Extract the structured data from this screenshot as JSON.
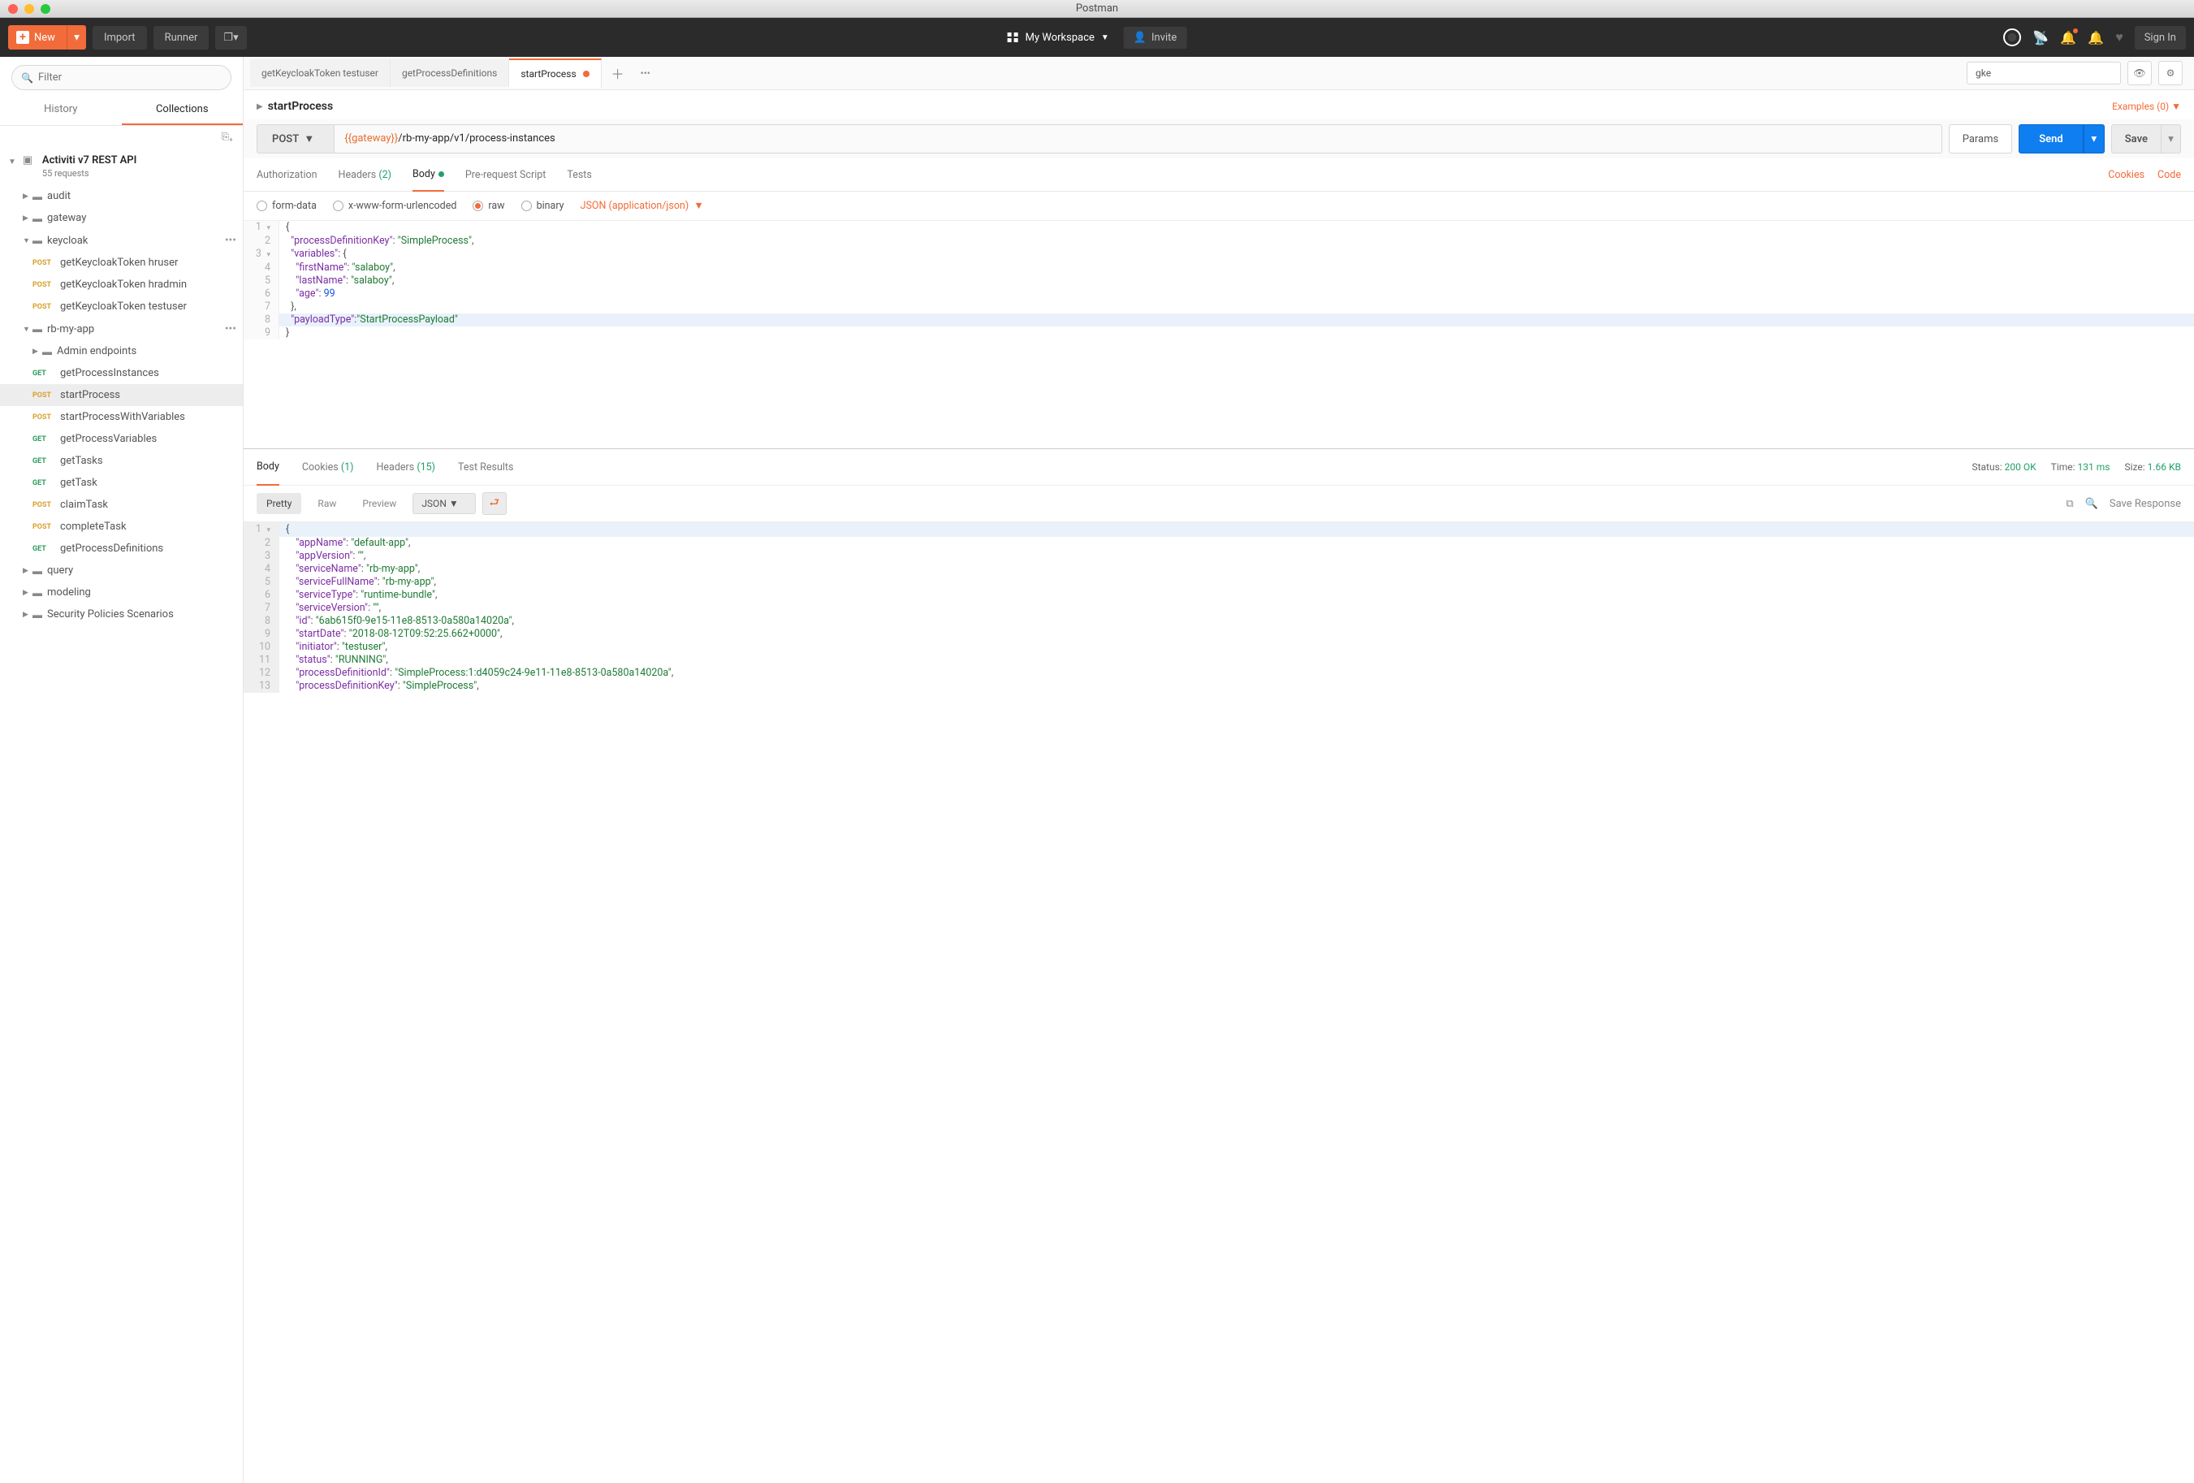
{
  "window_title": "Postman",
  "toolbar": {
    "new": "New",
    "import": "Import",
    "runner": "Runner",
    "workspace": "My Workspace",
    "invite": "Invite",
    "signin": "Sign In"
  },
  "sidebar": {
    "filter_placeholder": "Filter",
    "tabs": {
      "history": "History",
      "collections": "Collections"
    },
    "collection": {
      "name": "Activiti v7 REST API",
      "sub": "55 requests"
    },
    "folders": {
      "audit": "audit",
      "gateway": "gateway",
      "keycloak": "keycloak",
      "rbmyapp": "rb-my-app",
      "admin": "Admin endpoints",
      "query": "query",
      "modeling": "modeling",
      "security": "Security Policies Scenarios"
    },
    "requests": {
      "kc_hruser": "getKeycloakToken hruser",
      "kc_hradmin": "getKeycloakToken hradmin",
      "kc_testuser": "getKeycloakToken testuser",
      "getProcessInstances": "getProcessInstances",
      "startProcess": "startProcess",
      "startProcessWithVariables": "startProcessWithVariables",
      "getProcessVariables": "getProcessVariables",
      "getTasks": "getTasks",
      "getTask": "getTask",
      "claimTask": "claimTask",
      "completeTask": "completeTask",
      "getProcessDefinitions": "getProcessDefinitions"
    }
  },
  "tabs": {
    "t1": "getKeycloakToken testuser",
    "t2": "getProcessDefinitions",
    "t3": "startProcess"
  },
  "env": {
    "selected": "gke"
  },
  "request": {
    "name": "startProcess",
    "examples": "Examples (0)",
    "method": "POST",
    "url_var": "{{gateway}}",
    "url_path": "/rb-my-app/v1/process-instances",
    "params": "Params",
    "send": "Send",
    "save": "Save",
    "subtabs": {
      "auth": "Authorization",
      "headers": "Headers",
      "headers_count": "(2)",
      "body": "Body",
      "prs": "Pre-request Script",
      "tests": "Tests"
    },
    "links": {
      "cookies": "Cookies",
      "code": "Code"
    },
    "body_types": {
      "form": "form-data",
      "url": "x-www-form-urlencoded",
      "raw": "raw",
      "binary": "binary",
      "json_select": "JSON (application/json)"
    },
    "body_json": {
      "processDefinitionKey": "SimpleProcess",
      "variables_firstName": "salaboy",
      "variables_lastName": "salaboy",
      "variables_age": "99",
      "payloadType": "StartProcessPayload"
    }
  },
  "response": {
    "subtabs": {
      "body": "Body",
      "cookies": "Cookies",
      "cookies_count": "(1)",
      "headers": "Headers",
      "headers_count": "(15)",
      "tests": "Test Results"
    },
    "status_label": "Status:",
    "status_value": "200 OK",
    "time_label": "Time:",
    "time_value": "131 ms",
    "size_label": "Size:",
    "size_value": "1.66 KB",
    "views": {
      "pretty": "Pretty",
      "raw": "Raw",
      "preview": "Preview",
      "json": "JSON"
    },
    "save_response": "Save Response",
    "body": {
      "appName": "default-app",
      "appVersion": "",
      "serviceName": "rb-my-app",
      "serviceFullName": "rb-my-app",
      "serviceType": "runtime-bundle",
      "serviceVersion": "",
      "id": "6ab615f0-9e15-11e8-8513-0a580a14020a",
      "startDate": "2018-08-12T09:52:25.662+0000",
      "initiator": "testuser",
      "status": "RUNNING",
      "processDefinitionId": "SimpleProcess:1:d4059c24-9e11-11e8-8513-0a580a14020a",
      "processDefinitionKey": "SimpleProcess"
    }
  }
}
